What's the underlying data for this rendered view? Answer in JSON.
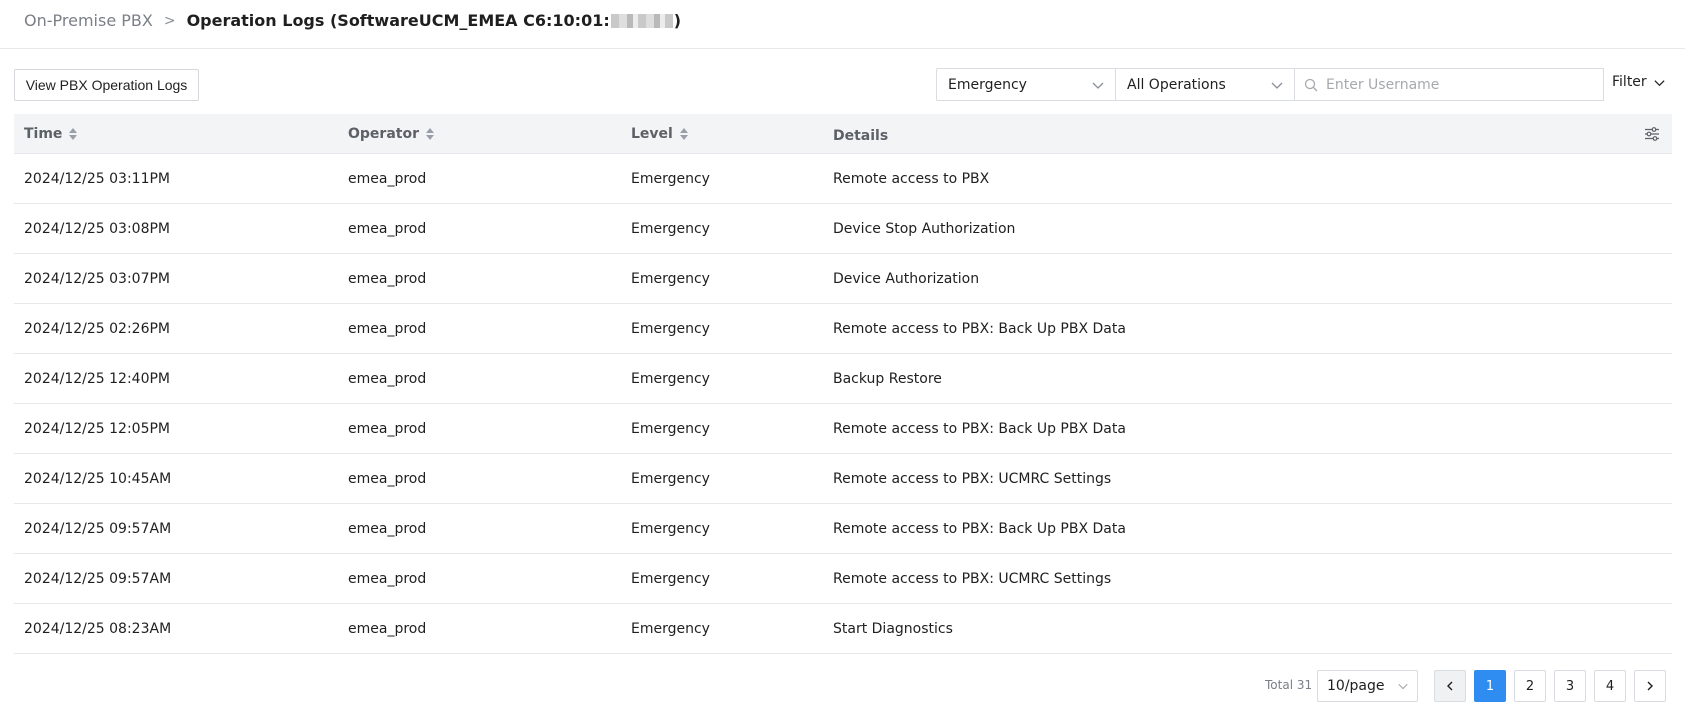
{
  "breadcrumb": {
    "parent": "On-Premise PBX",
    "separator": ">",
    "title_prefix": "Operation Logs (SoftwareUCM_EMEA C6:10:01:",
    "title_suffix": ")"
  },
  "toolbar": {
    "view_button": "View PBX Operation Logs",
    "level_select": "Emergency",
    "operations_select": "All Operations",
    "search_placeholder": "Enter Username",
    "filter_label": "Filter"
  },
  "table": {
    "columns": [
      "Time",
      "Operator",
      "Level",
      "Details"
    ],
    "rows": [
      {
        "time": "2024/12/25 03:11PM",
        "operator": "emea_prod",
        "level": "Emergency",
        "details": "Remote access to PBX"
      },
      {
        "time": "2024/12/25 03:08PM",
        "operator": "emea_prod",
        "level": "Emergency",
        "details": "Device Stop Authorization"
      },
      {
        "time": "2024/12/25 03:07PM",
        "operator": "emea_prod",
        "level": "Emergency",
        "details": "Device Authorization"
      },
      {
        "time": "2024/12/25 02:26PM",
        "operator": "emea_prod",
        "level": "Emergency",
        "details": "Remote access to PBX: Back Up PBX Data"
      },
      {
        "time": "2024/12/25 12:40PM",
        "operator": "emea_prod",
        "level": "Emergency",
        "details": "Backup Restore"
      },
      {
        "time": "2024/12/25 12:05PM",
        "operator": "emea_prod",
        "level": "Emergency",
        "details": "Remote access to PBX: Back Up PBX Data"
      },
      {
        "time": "2024/12/25 10:45AM",
        "operator": "emea_prod",
        "level": "Emergency",
        "details": "Remote access to PBX: UCMRC Settings"
      },
      {
        "time": "2024/12/25 09:57AM",
        "operator": "emea_prod",
        "level": "Emergency",
        "details": "Remote access to PBX: Back Up PBX Data"
      },
      {
        "time": "2024/12/25 09:57AM",
        "operator": "emea_prod",
        "level": "Emergency",
        "details": "Remote access to PBX: UCMRC Settings"
      },
      {
        "time": "2024/12/25 08:23AM",
        "operator": "emea_prod",
        "level": "Emergency",
        "details": "Start Diagnostics"
      }
    ]
  },
  "pagination": {
    "total": "Total 31",
    "page_size": "10/page",
    "pages": [
      "1",
      "2",
      "3",
      "4"
    ],
    "current_page": "1"
  },
  "colors": {
    "accent": "#2f8cf0",
    "header_bg": "#f3f4f6",
    "border": "#e6e8eb"
  }
}
